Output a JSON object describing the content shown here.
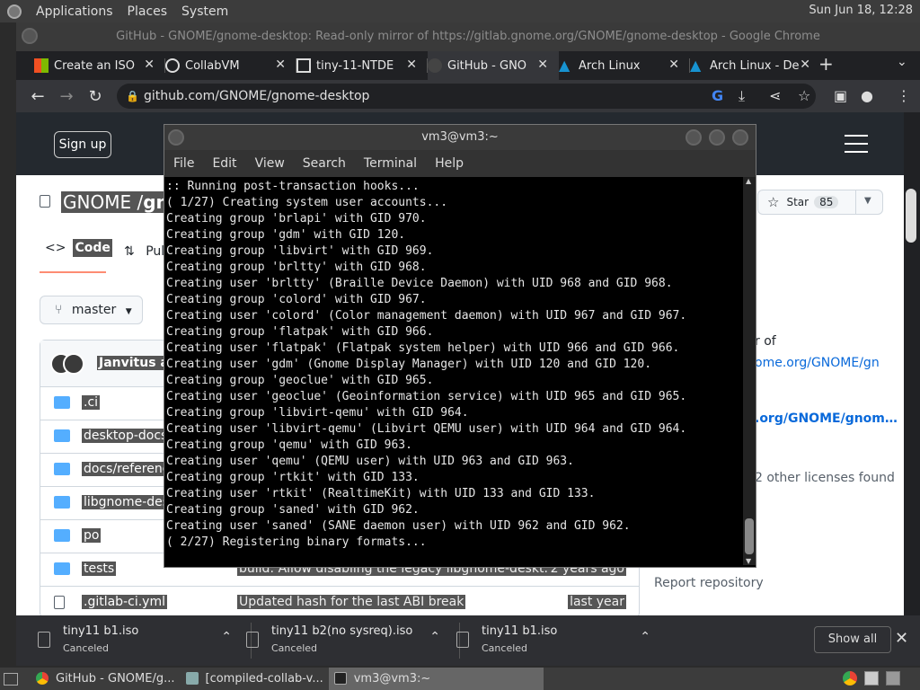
{
  "panel": {
    "apps": "Applications",
    "places": "Places",
    "system": "System",
    "clock": "Sun Jun 18, 12:28"
  },
  "chrome": {
    "title": "GitHub - GNOME/gnome-desktop: Read-only mirror of https://gitlab.gnome.org/GNOME/gnome-desktop - Google Chrome",
    "tabs": [
      {
        "label": "Create an ISO",
        "close": "✕"
      },
      {
        "label": "CollabVM",
        "close": "✕"
      },
      {
        "label": "tiny-11-NTDE",
        "close": "✕"
      },
      {
        "label": "GitHub - GNO",
        "close": "✕"
      },
      {
        "label": "Arch Linux",
        "close": "✕"
      },
      {
        "label": "Arch Linux - De",
        "close": "✕"
      }
    ],
    "new_tab": "+",
    "url": "github.com/GNOME/gnome-desktop"
  },
  "github": {
    "signup": "Sign up",
    "owner": "GNOME /",
    "repo": "gn",
    "star_label": "Star",
    "star_count": "85",
    "code_tab": "Code",
    "pull_tab": "Pul",
    "branch": "master",
    "committer": "Janvitus ar",
    "files": [
      {
        "name": ".ci",
        "type": "dir",
        "msg": "",
        "age": ""
      },
      {
        "name": "desktop-docs",
        "type": "dir",
        "msg": "",
        "age": ""
      },
      {
        "name": "docs/reference",
        "type": "dir",
        "msg": "",
        "age": ""
      },
      {
        "name": "libgnome-desk",
        "type": "dir",
        "msg": "",
        "age": ""
      },
      {
        "name": "po",
        "type": "dir",
        "msg": "",
        "age": ""
      },
      {
        "name": "tests",
        "type": "dir",
        "msg": "build: Allow disabling the legacy libgnome-deskt...",
        "age": "2 years ago"
      },
      {
        "name": ".gitlab-ci.yml",
        "type": "file",
        "msg": "Updated hash for the last ABI break",
        "age": "last year"
      }
    ],
    "about_1": "r of",
    "about_2": "ome.org/GNOME/gn",
    "about_3": ".org/GNOME/gnom…",
    "about_4": "2 other licenses found",
    "report": "Report repository"
  },
  "terminal": {
    "title": "vm3@vm3:~",
    "menu": [
      "File",
      "Edit",
      "View",
      "Search",
      "Terminal",
      "Help"
    ],
    "lines": [
      ":: Running post-transaction hooks...",
      "( 1/27) Creating system user accounts...",
      "Creating group 'brlapi' with GID 970.",
      "Creating group 'gdm' with GID 120.",
      "Creating group 'libvirt' with GID 969.",
      "Creating group 'brltty' with GID 968.",
      "Creating user 'brltty' (Braille Device Daemon) with UID 968 and GID 968.",
      "Creating group 'colord' with GID 967.",
      "Creating user 'colord' (Color management daemon) with UID 967 and GID 967.",
      "Creating group 'flatpak' with GID 966.",
      "Creating user 'flatpak' (Flatpak system helper) with UID 966 and GID 966.",
      "Creating user 'gdm' (Gnome Display Manager) with UID 120 and GID 120.",
      "Creating group 'geoclue' with GID 965.",
      "Creating user 'geoclue' (Geoinformation service) with UID 965 and GID 965.",
      "Creating group 'libvirt-qemu' with GID 964.",
      "Creating user 'libvirt-qemu' (Libvirt QEMU user) with UID 964 and GID 964.",
      "Creating group 'qemu' with GID 963.",
      "Creating user 'qemu' (QEMU user) with UID 963 and GID 963.",
      "Creating group 'rtkit' with GID 133.",
      "Creating user 'rtkit' (RealtimeKit) with UID 133 and GID 133.",
      "Creating group 'saned' with GID 962.",
      "Creating user 'saned' (SANE daemon user) with UID 962 and GID 962.",
      "( 2/27) Registering binary formats..."
    ]
  },
  "downloads": [
    {
      "name": "tiny11 b1.iso",
      "status": "Canceled"
    },
    {
      "name": "tiny11 b2(no sysreq).iso",
      "status": "Canceled"
    },
    {
      "name": "tiny11 b1.iso",
      "status": "Canceled"
    }
  ],
  "show_all": "Show all",
  "taskbar": [
    {
      "label": "GitHub - GNOME/g..."
    },
    {
      "label": "[compiled-collab-v..."
    },
    {
      "label": "vm3@vm3:~"
    }
  ],
  "colors": {
    "accent": "#0969da",
    "gh_header": "#24292f",
    "chrome_dark": "#202124"
  }
}
